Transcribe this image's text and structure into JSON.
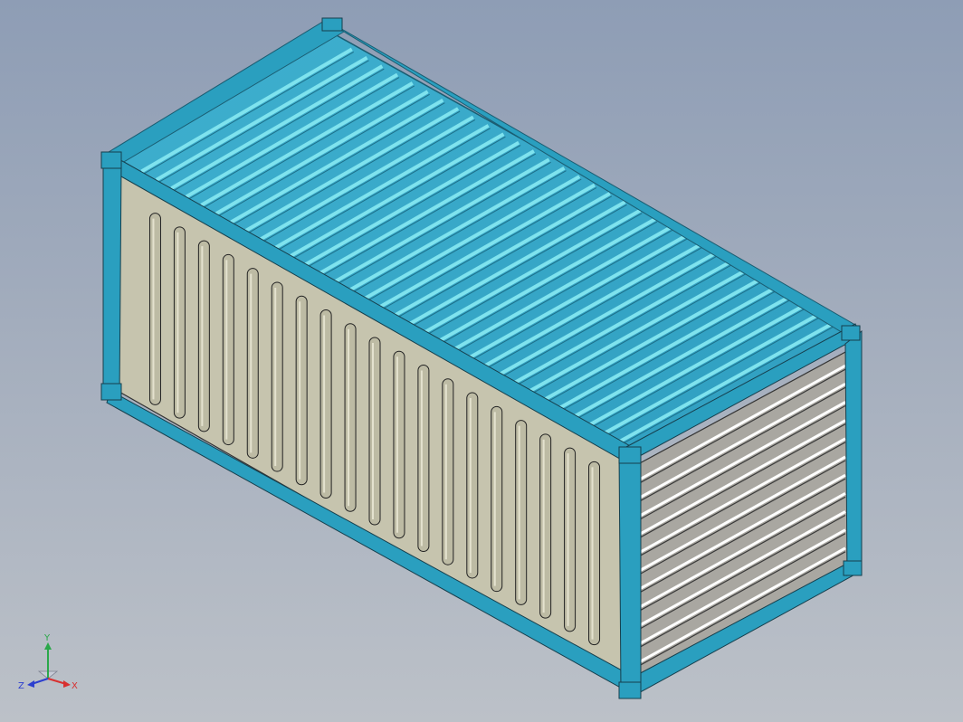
{
  "viewport": {
    "background_top": "#8e9db5",
    "background_bottom": "#bcc1c8"
  },
  "model": {
    "name": "shipping-container",
    "frame_color": "#2a9fbf",
    "frame_dark": "#1d7f9c",
    "roof_color": "#3aa9c8",
    "roof_rib_color": "#7fe3ee",
    "side_wall_color": "#c6c4ae",
    "end_wall_color": "#a9a7a1",
    "end_wall_highlight": "#ffffff",
    "side_corrugation_count": 19,
    "roof_rib_count": 34,
    "end_panel_count": 11
  },
  "triad": {
    "x_label": "X",
    "y_label": "Y",
    "z_label": "Z",
    "x_color": "#d83030",
    "y_color": "#2aa84a",
    "z_color": "#2c3fcf"
  }
}
